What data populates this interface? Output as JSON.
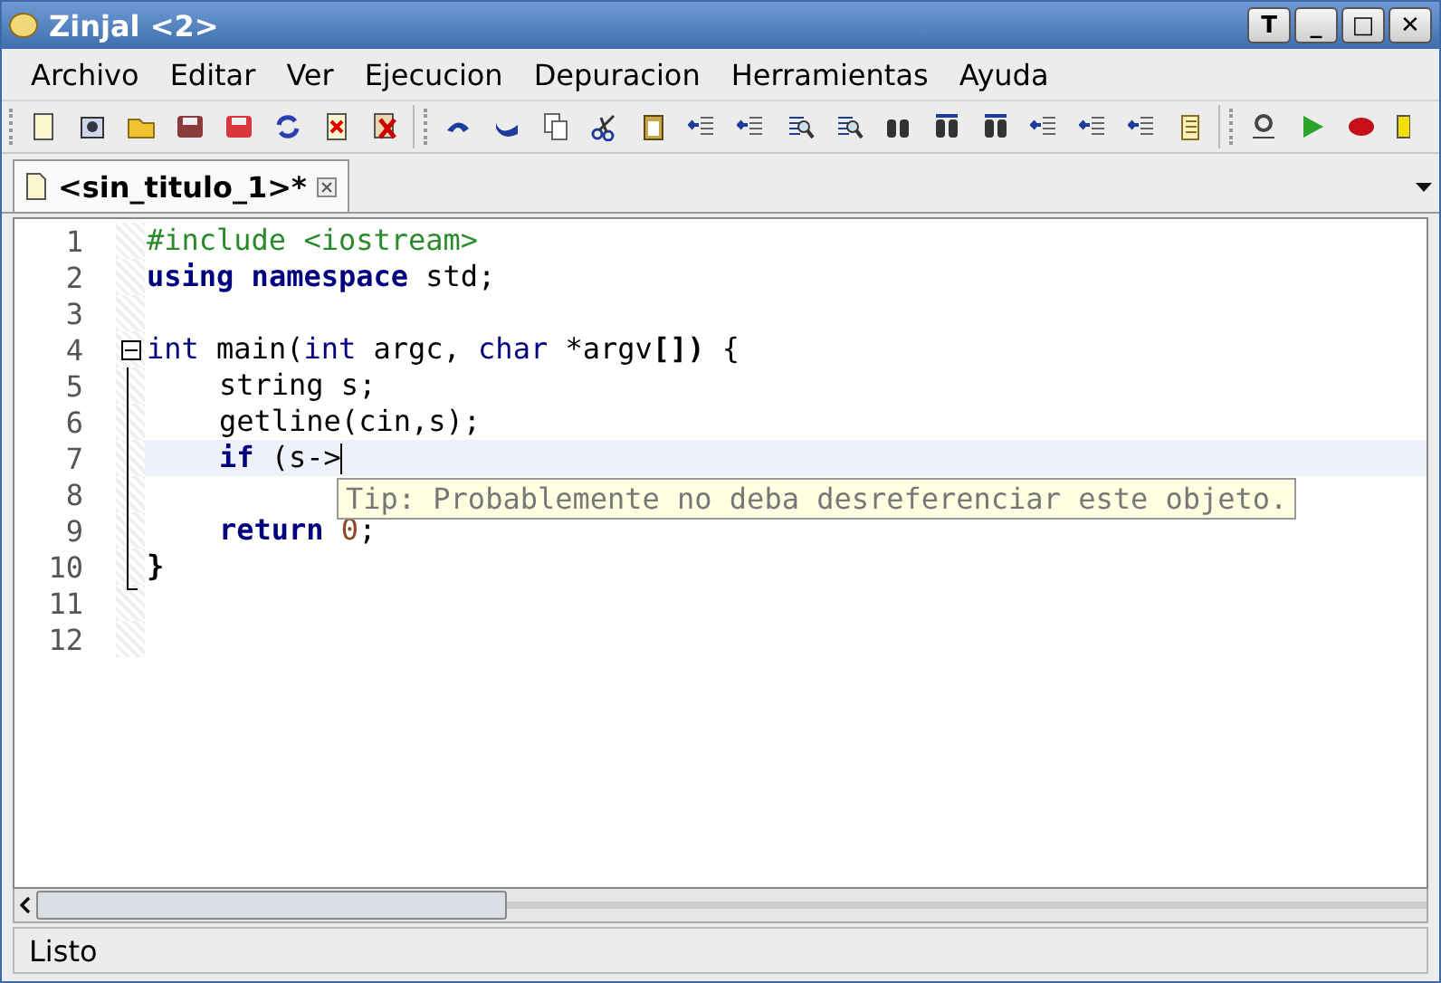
{
  "window": {
    "title": "Zinjal <2>",
    "controls": [
      "T",
      "_",
      "□",
      "✕"
    ]
  },
  "menu": [
    "Archivo",
    "Editar",
    "Ver",
    "Ejecucion",
    "Depuracion",
    "Herramientas",
    "Ayuda"
  ],
  "tabs": [
    {
      "label": "<sin_titulo_1>*",
      "selected": true
    }
  ],
  "editor": {
    "lines": [
      {
        "number": "1",
        "current": false,
        "fold": false,
        "indented": false,
        "tokens": [
          {
            "text": "#include <iostream>",
            "kind": "pp"
          }
        ]
      },
      {
        "number": "2",
        "current": false,
        "fold": false,
        "indented": false,
        "tokens": [
          {
            "text": "using",
            "kind": "kw"
          },
          {
            "text": " namespace",
            "kind": "kw"
          },
          {
            "text": " std;",
            "kind": "plain"
          }
        ]
      },
      {
        "number": "3",
        "current": false,
        "fold": false
      },
      {
        "number": "4",
        "current": false,
        "fold": true,
        "indented": false,
        "tokens": [
          {
            "text": "int",
            "kind": "type"
          },
          {
            "text": " main(",
            "kind": "plain"
          },
          {
            "text": "int",
            "kind": "type"
          },
          {
            "text": " argc, ",
            "kind": "plain"
          },
          {
            "text": "char",
            "kind": "type"
          },
          {
            "text": " *argv",
            "kind": "plain"
          },
          {
            "text": "[])",
            "kind": "bold"
          },
          {
            "text": " {",
            "kind": "plain"
          }
        ]
      },
      {
        "number": "5",
        "current": false,
        "fold": false,
        "indented": true,
        "tokens": [
          {
            "text": "string s;",
            "kind": "plain"
          }
        ]
      },
      {
        "number": "6",
        "current": false,
        "fold": false,
        "indented": true,
        "tokens": [
          {
            "text": "getline(cin,s);",
            "kind": "plain"
          }
        ]
      },
      {
        "number": "7",
        "current": true,
        "fold": false,
        "indented": true,
        "tokens": [
          {
            "text": "if",
            "kind": "kw"
          },
          {
            "text": " (s->",
            "kind": "plain"
          }
        ]
      },
      {
        "number": "8",
        "current": false,
        "fold": false
      },
      {
        "number": "9",
        "current": false,
        "fold": false,
        "indented": true,
        "tokens": [
          {
            "text": "return",
            "kind": "kw"
          },
          {
            "text": " 0",
            "kind": "num"
          },
          {
            "text": ";",
            "kind": "plain"
          }
        ]
      },
      {
        "number": "10",
        "current": false,
        "fold": false,
        "indented": false,
        "tokens": [
          {
            "text": "}",
            "kind": "bold"
          }
        ]
      },
      {
        "number": "11",
        "current": false,
        "fold": false
      },
      {
        "number": "12",
        "current": false,
        "fold": false
      }
    ],
    "tooltip": "Tip: Probablemente no deba desreferenciar este objeto."
  },
  "status_bar": "Listo"
}
